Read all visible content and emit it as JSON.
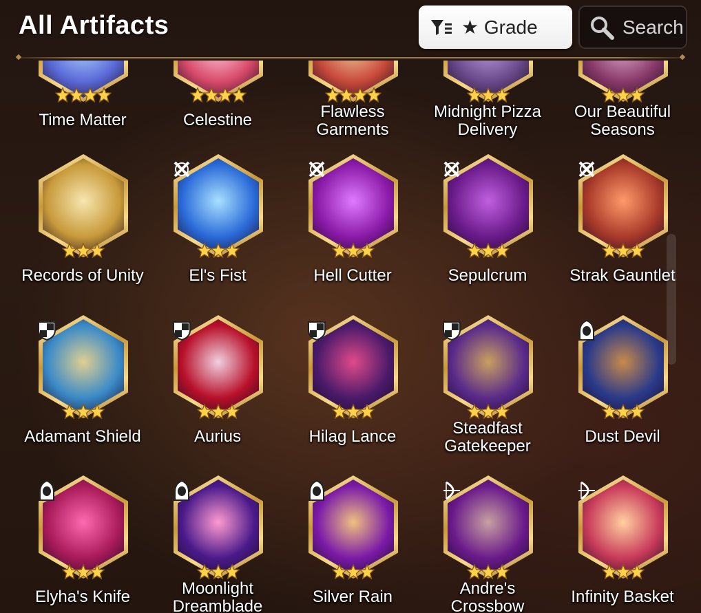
{
  "header": {
    "title": "All Artifacts",
    "grade_button": {
      "label": "★ Grade",
      "icon": "filter-icon"
    },
    "search_button": {
      "label": "Search",
      "icon": "search-icon"
    }
  },
  "rows": [
    {
      "items": [
        {
          "name_lines": [
            "Time Matter"
          ],
          "stars": 4,
          "class_icon": null,
          "palette": [
            "#5a6ad8",
            "#b2d6ff"
          ]
        },
        {
          "name_lines": [
            "Celestine"
          ],
          "stars": 4,
          "class_icon": null,
          "palette": [
            "#d84a6a",
            "#ffd0e0"
          ]
        },
        {
          "name_lines": [
            "Flawless",
            "Garments"
          ],
          "stars": 4,
          "class_icon": null,
          "palette": [
            "#c84a3a",
            "#f0d0a0"
          ]
        },
        {
          "name_lines": [
            "Midnight Pizza",
            "Delivery"
          ],
          "stars": 3,
          "class_icon": null,
          "palette": [
            "#6a4a8a",
            "#c0a0e0"
          ]
        },
        {
          "name_lines": [
            "Our Beautiful",
            "Seasons"
          ],
          "stars": 3,
          "class_icon": null,
          "palette": [
            "#8a3a6a",
            "#e0b0d0"
          ]
        }
      ]
    },
    {
      "items": [
        {
          "name_lines": [
            "Records of Unity"
          ],
          "stars": 3,
          "class_icon": null,
          "palette": [
            "#c89a3a",
            "#f7e6b0"
          ]
        },
        {
          "name_lines": [
            "El's Fist"
          ],
          "stars": 3,
          "class_icon": "warrior-icon",
          "palette": [
            "#2a6ad8",
            "#a8e0ff"
          ]
        },
        {
          "name_lines": [
            "Hell Cutter"
          ],
          "stars": 3,
          "class_icon": "warrior-icon",
          "palette": [
            "#8a1aa8",
            "#e07aff"
          ]
        },
        {
          "name_lines": [
            "Sepulcrum"
          ],
          "stars": 3,
          "class_icon": "warrior-icon",
          "palette": [
            "#6a1a8a",
            "#c060e0"
          ]
        },
        {
          "name_lines": [
            "Strak Gauntlet"
          ],
          "stars": 3,
          "class_icon": "warrior-icon",
          "palette": [
            "#a83a2a",
            "#ff9a6a"
          ]
        }
      ]
    },
    {
      "items": [
        {
          "name_lines": [
            "Adamant Shield"
          ],
          "stars": 3,
          "class_icon": "knight-icon",
          "palette": [
            "#3a8ac8",
            "#e0d090"
          ]
        },
        {
          "name_lines": [
            "Aurius"
          ],
          "stars": 3,
          "class_icon": "knight-icon",
          "palette": [
            "#b8102a",
            "#f0d0e0"
          ]
        },
        {
          "name_lines": [
            "Hilag Lance"
          ],
          "stars": 3,
          "class_icon": "knight-icon",
          "palette": [
            "#4a1a6a",
            "#e04a8a"
          ]
        },
        {
          "name_lines": [
            "Steadfast",
            "Gatekeeper"
          ],
          "stars": 3,
          "class_icon": "knight-icon",
          "palette": [
            "#5a2a8a",
            "#c8a060"
          ]
        },
        {
          "name_lines": [
            "Dust Devil"
          ],
          "stars": 3,
          "class_icon": "thief-icon",
          "palette": [
            "#2a3a8a",
            "#c88a4a"
          ]
        }
      ]
    },
    {
      "items": [
        {
          "name_lines": [
            "Elyha's Knife"
          ],
          "stars": 3,
          "class_icon": "thief-icon",
          "palette": [
            "#a81a5a",
            "#ff6ab0"
          ]
        },
        {
          "name_lines": [
            "Moonlight",
            "Dreamblade"
          ],
          "stars": 3,
          "class_icon": "thief-icon",
          "palette": [
            "#4a1a8a",
            "#ff9acf"
          ]
        },
        {
          "name_lines": [
            "Silver Rain"
          ],
          "stars": 3,
          "class_icon": "thief-icon",
          "palette": [
            "#7a1aa8",
            "#f0c080"
          ]
        },
        {
          "name_lines": [
            "Andre's",
            "Crossbow"
          ],
          "stars": 3,
          "class_icon": "ranger-icon",
          "palette": [
            "#6a1a8a",
            "#c8a0a0"
          ]
        },
        {
          "name_lines": [
            "Infinity Basket"
          ],
          "stars": 3,
          "class_icon": "ranger-icon",
          "palette": [
            "#c83a5a",
            "#ffd0a0"
          ]
        }
      ]
    }
  ],
  "colors": {
    "accent_gold": "#c99a3c",
    "star_gold": "#ffd24a"
  }
}
